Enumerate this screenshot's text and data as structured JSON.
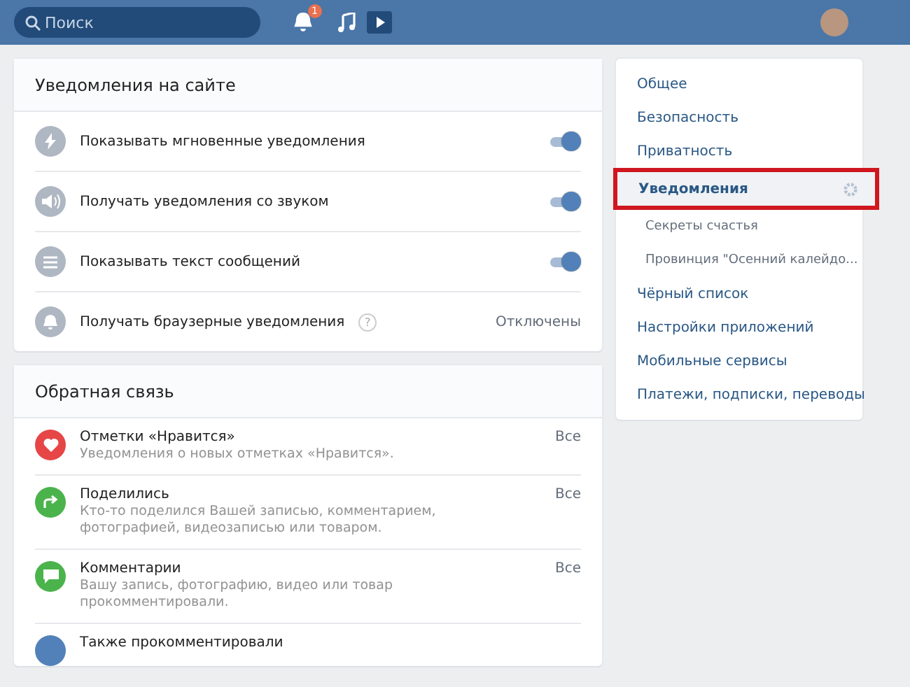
{
  "header": {
    "search": {
      "placeholder": "Поиск"
    },
    "notification_badge": "1"
  },
  "site_notifications": {
    "title": "Уведомления на сайте",
    "rows": [
      {
        "kind": "toggle",
        "label": "Показывать мгновенные уведомления",
        "on": true
      },
      {
        "kind": "toggle",
        "label": "Получать уведомления со звуком",
        "on": true
      },
      {
        "kind": "toggle",
        "label": "Показывать текст сообщений",
        "on": true
      },
      {
        "kind": "value",
        "label": "Получать браузерные уведомления",
        "help": "?",
        "value": "Отключены"
      }
    ]
  },
  "feedback": {
    "title": "Обратная связь",
    "rows": [
      {
        "color": "#e64646",
        "title": "Отметки «Нравится»",
        "description": "Уведомления о новых отметках «Нравится».",
        "value": "Все"
      },
      {
        "color": "#4bb34b",
        "title": "Поделились",
        "description": "Кто-то поделился Вашей записью, комментарием, фотографией, видеозаписью или товаром.",
        "value": "Все"
      },
      {
        "color": "#4bb34b",
        "title": "Комментарии",
        "description": "Вашу запись, фотографию, видео или товар прокомментировали.",
        "value": "Все"
      },
      {
        "color": "#5181b8",
        "title": "Также прокомментировали"
      }
    ]
  },
  "settings_menu": {
    "items": [
      {
        "label": "Общее",
        "selected": false
      },
      {
        "label": "Безопасность",
        "selected": false
      },
      {
        "label": "Приватность",
        "selected": false
      },
      {
        "label": "Уведомления",
        "selected": true,
        "children": [
          {
            "label": "Секреты счастья",
            "selected": false
          },
          {
            "label": "Провинция \"Осенний калейдо...",
            "selected": false
          }
        ]
      },
      {
        "label": "Чёрный список",
        "selected": false
      },
      {
        "label": "Настройки приложений",
        "selected": false
      },
      {
        "label": "Мобильные сервисы",
        "selected": false
      },
      {
        "label": "Платежи, подписки, переводы",
        "selected": false
      }
    ]
  }
}
